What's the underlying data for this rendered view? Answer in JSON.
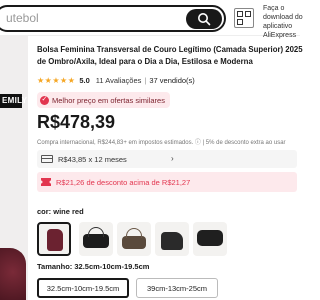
{
  "header": {
    "search_text": "utebol",
    "app_promo": "Faça o download do aplicativo AliExpress"
  },
  "gallery": {
    "badge": "EMILY"
  },
  "product": {
    "title": "Bolsa Feminina Transversal de Couro Legítimo (Camada Superior) 2025 de Ombro/Axila, Ideal para o Dia a Dia, Estilosa e Moderna",
    "stars": "★★★★★",
    "rating": "5.0",
    "reviews": "11 Avaliações",
    "separator": "|",
    "sold": "37 vendido(s)",
    "best_price": "Melhor preço em ofertas similares",
    "price": "R$478,39",
    "price_note": "Compra internacional, R$244,83+ em impostos estimados. ⓘ | 5% de desconto extra ao usar",
    "installment": "R$43,85 x 12 meses",
    "installment_chevron": "›",
    "discount": "R$21,26 de desconto acima de R$21,27"
  },
  "variants": {
    "color_label": "cor: wine red",
    "colors": [
      {
        "name": "wine red",
        "color": "#6b2230"
      },
      {
        "name": "black",
        "color": "#1c1c1c"
      },
      {
        "name": "brown",
        "color": "#5a4a3c"
      },
      {
        "name": "black-2",
        "color": "#2a2a2a"
      },
      {
        "name": "black-3",
        "color": "#1f1f1f"
      }
    ],
    "size_label": "Tamanho: 32.5cm-10cm-19.5cm",
    "sizes": [
      "32.5cm-10cm-19.5cm",
      "39cm-13cm-25cm"
    ]
  },
  "colors": {
    "accent": "#e2354f",
    "star": "#f5a623",
    "text": "#191919"
  }
}
